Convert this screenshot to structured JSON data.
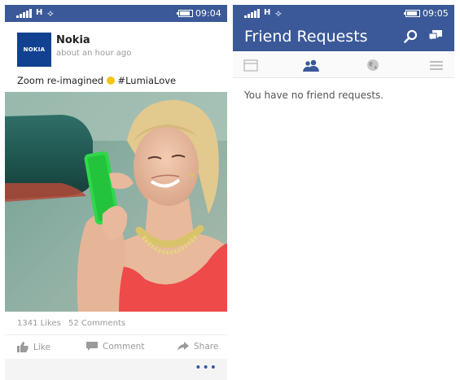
{
  "left": {
    "status": {
      "network": "H",
      "time": "09:04"
    },
    "post": {
      "logo_text": "NOKIA",
      "author": "Nokia",
      "timestamp": "about an hour ago",
      "text_before": "Zoom re-imagined ",
      "text_after": " #LumiaLove",
      "likes": "1341 Likes",
      "comments": "52 Comments"
    },
    "actions": {
      "like": "Like",
      "comment": "Comment",
      "share": "Share"
    },
    "more": "•••"
  },
  "right": {
    "status": {
      "network": "H",
      "time": "09:05"
    },
    "title": "Friend Requests",
    "tabs": [
      "news-feed-icon",
      "friends-icon",
      "globe-icon",
      "menu-icon"
    ],
    "empty_message": "You have no friend requests."
  },
  "colors": {
    "brand": "#3b5998",
    "nokia": "#124191",
    "muted": "#9a9a9a"
  }
}
